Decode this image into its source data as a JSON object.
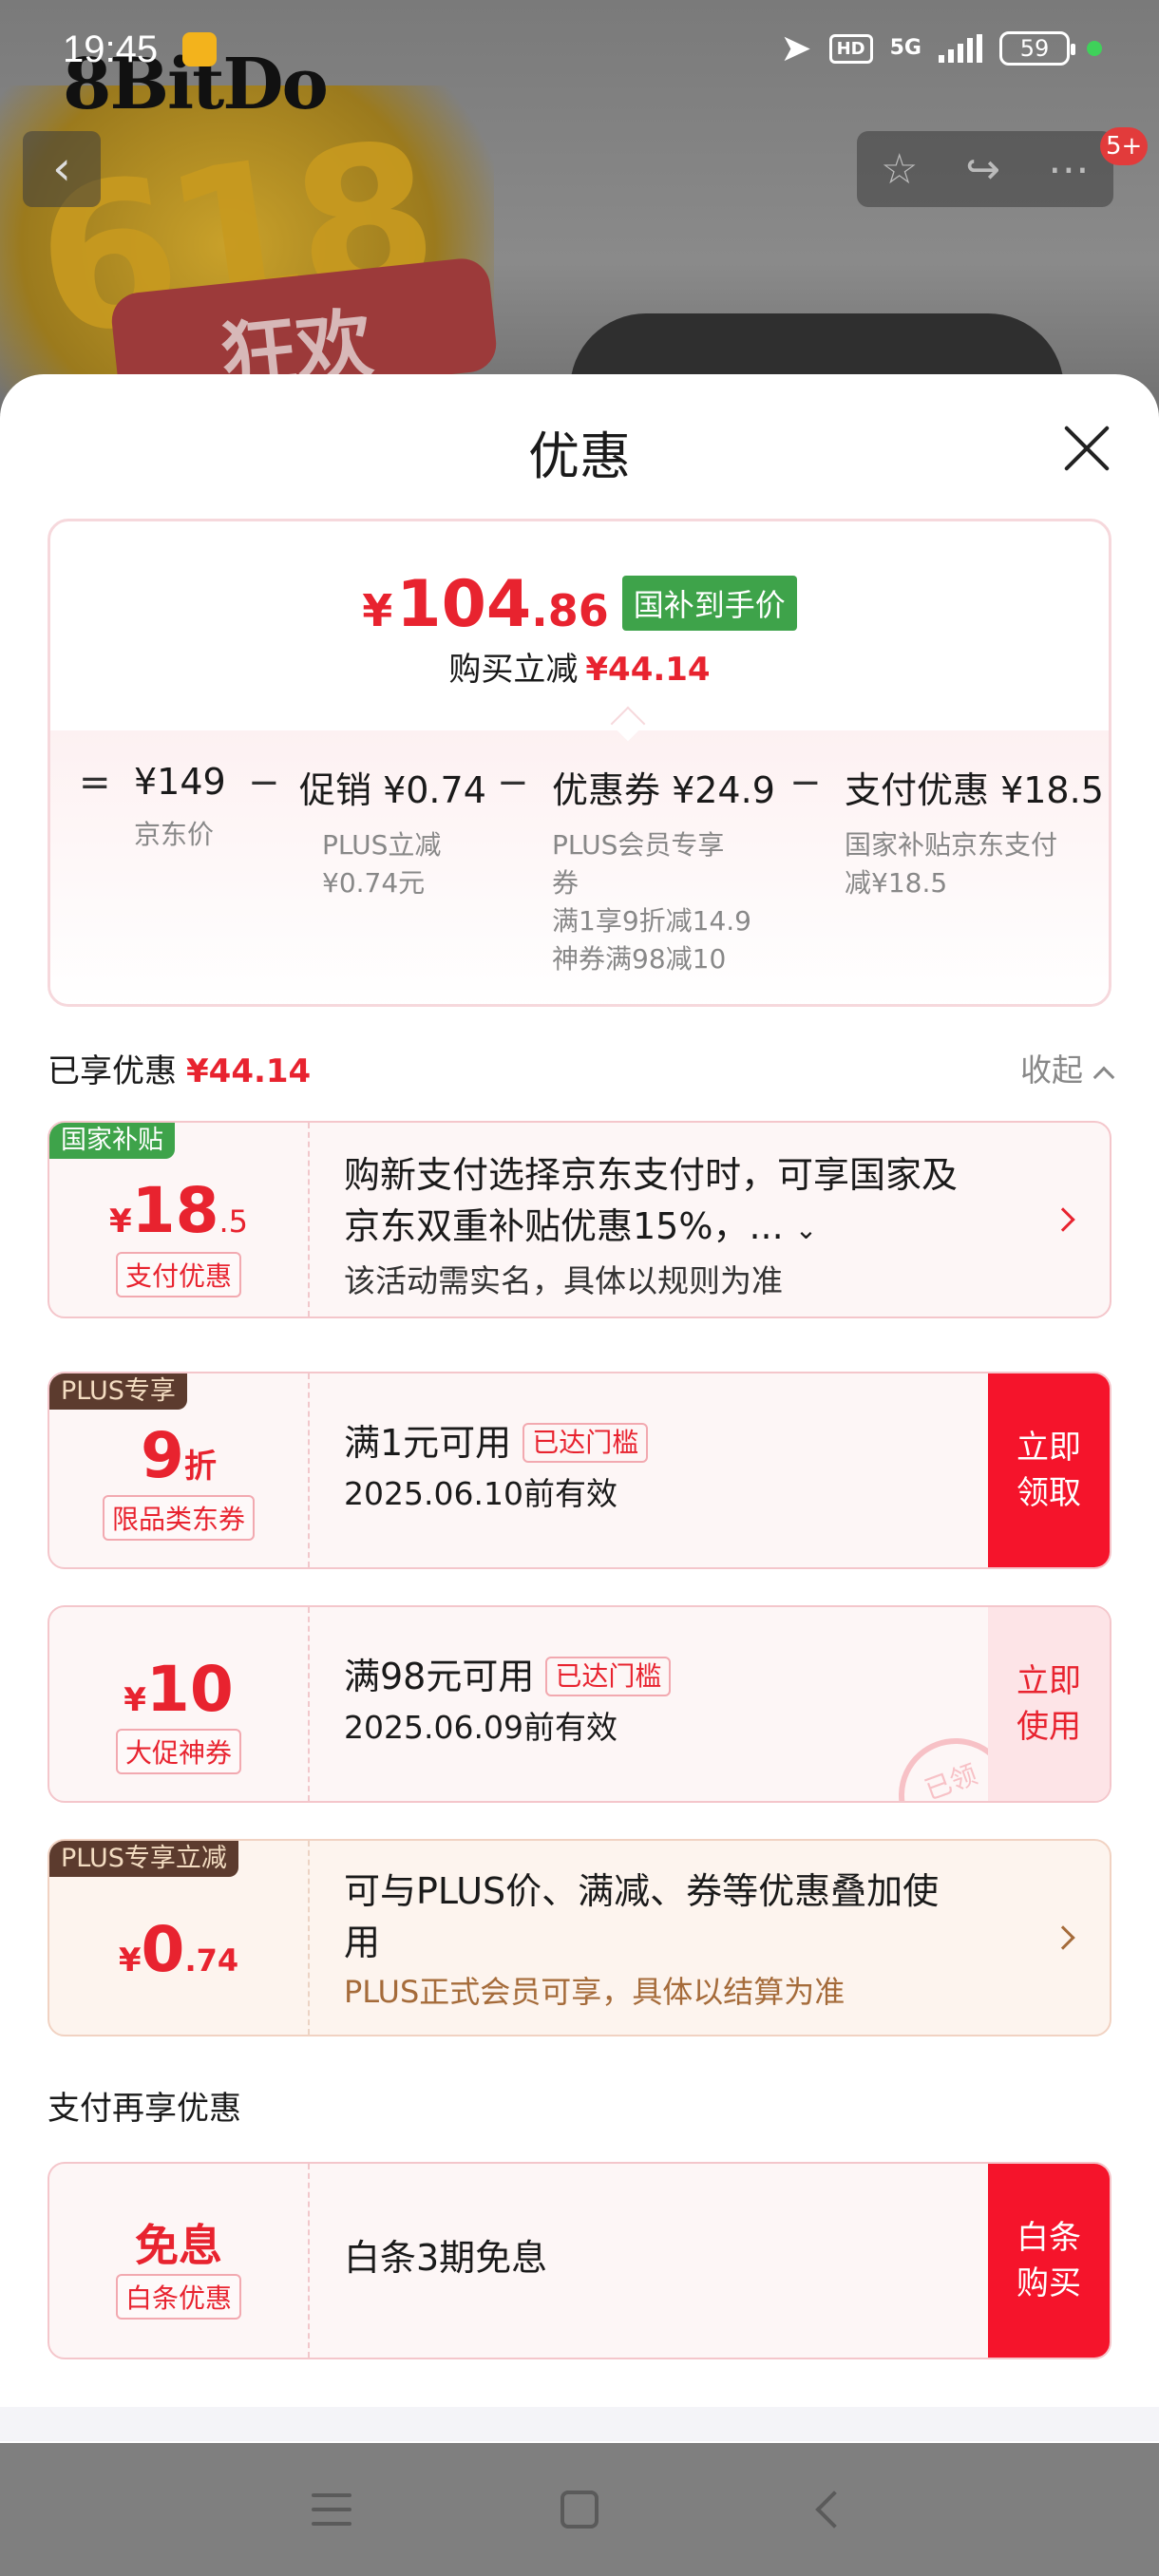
{
  "status_bar": {
    "time": "19:45",
    "hd": "HD",
    "network": "5G",
    "battery": "59"
  },
  "banner": {
    "brand": "8BitDo",
    "promo_number": "618",
    "promo_text": "狂欢",
    "notification_count": "5+"
  },
  "sheet": {
    "title": "优惠",
    "summary": {
      "yen": "¥",
      "final_price_int": "104",
      "final_price_dec": ".86",
      "tag": "国补到手价",
      "reduce_label": "购买立减",
      "reduce_amount": "¥44.14",
      "equation": {
        "eq": "=",
        "minus": "−",
        "jd_price": "¥149",
        "jd_price_label": "京东价",
        "promo": "促销 ¥0.74",
        "promo_sub1": "PLUS立减",
        "promo_sub2": "¥0.74元",
        "coupon": "优惠券 ¥24.9",
        "coupon_sub1": "PLUS会员专享",
        "coupon_sub2": "券",
        "coupon_sub3": "满1享9折减14.9",
        "coupon_sub4": "神券满98减10",
        "pay": "支付优惠 ¥18.5",
        "pay_sub1": "国家补贴京东支付",
        "pay_sub2": "减¥18.5"
      }
    },
    "enjoyed_label": "已享优惠",
    "enjoyed_amount": "¥44.14",
    "collapse_label": "收起",
    "cards": [
      {
        "corner": "国家补贴",
        "yen": "¥",
        "int": "18",
        "dec": ".5",
        "chip": "支付优惠",
        "line1": "购新支付选择京东支付时，可享国家及",
        "line2": "京东双重补贴优惠15%，...",
        "line3": "该活动需实名，具体以规则为准"
      },
      {
        "corner": "PLUS专享",
        "int": "9",
        "unit": "折",
        "chip": "限品类东券",
        "line1": "满1元可用",
        "gate": "已达门槛",
        "line2": "2025.06.10前有效",
        "button": "立即领取"
      },
      {
        "yen": "¥",
        "int": "10",
        "chip": "大促神券",
        "line1": "满98元可用",
        "gate": "已达门槛",
        "line2": "2025.06.09前有效",
        "button": "立即使用",
        "stamp": "已领"
      },
      {
        "corner": "PLUS专享立减",
        "yen": "¥",
        "int": "0",
        "dec": ".74",
        "line1": "可与PLUS价、满减、券等优惠叠加使",
        "line2": "用",
        "line3": "PLUS正式会员可享，具体以结算为准"
      }
    ],
    "pay_again_label": "支付再享优惠",
    "baitiao_card": {
      "title": "免息",
      "chip": "白条优惠",
      "text": "白条3期免息",
      "button": "白条购买"
    }
  },
  "colors": {
    "accent_red": "#e8232f",
    "button_red": "#f5142b",
    "green_tag": "#3ea34a",
    "plus_brown": "#5c3b2e"
  }
}
